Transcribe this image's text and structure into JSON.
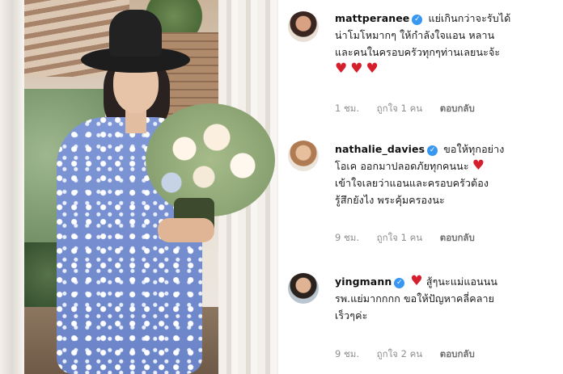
{
  "comments": [
    {
      "username": "mattperanee",
      "text_lines": [
        "แย่เกินกว่าจะรับได้",
        "น่าโมโหมากๆ ให้กำลังใจแอน หลาน",
        "และคนในครอบครัวทุกๆท่านเลยนะจ้ะ"
      ],
      "hearts": "♥♥♥",
      "time": "1 ชม.",
      "likes": "ถูกใจ 1 คน",
      "reply": "ตอบกลับ"
    },
    {
      "username": "nathalie_davies",
      "text_lines": [
        "ขอให้ทุกอย่าง",
        "โอเค ออกมาปลอดภัยทุกคนนะ",
        "เข้าใจเลยว่าแอนและครอบครัวต้อง",
        "รู้สึกยังไง พระคุ้มครองนะ"
      ],
      "inline_heart": "♥",
      "time": "9 ชม.",
      "likes": "ถูกใจ 1 คน",
      "reply": "ตอบกลับ"
    },
    {
      "username": "yingmann",
      "text_lines": [
        "สู้ๆนะแม่แอนนน",
        "รพ.แย่มากกกก ขอให้ปัญหาคลี่คลาย",
        "เร็วๆค่ะ"
      ],
      "inline_heart": "♥",
      "time": "9 ชม.",
      "likes": "ถูกใจ 2 คน",
      "reply": "ตอบกลับ"
    }
  ],
  "verified_mark": "✓",
  "colors": {
    "verified": "#3897f0",
    "heart": "#d61f2c",
    "meta": "#8e8e8e"
  },
  "icons": {
    "verified": "verified-badge-icon",
    "heart": "heart-icon"
  }
}
